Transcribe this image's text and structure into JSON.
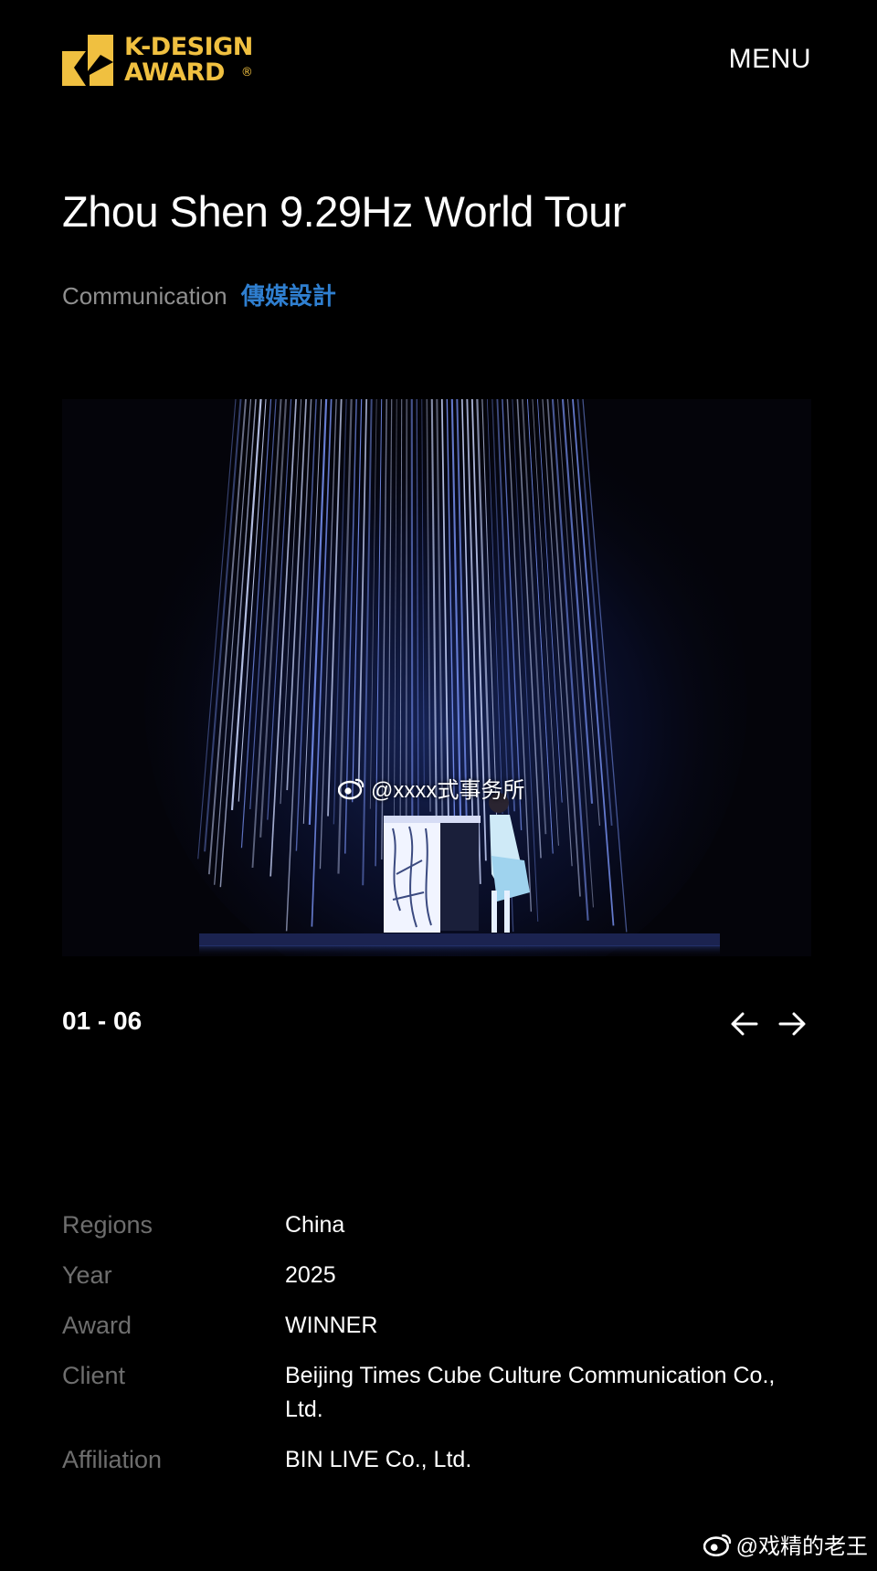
{
  "header": {
    "logo": {
      "line1": "K-DESIGN",
      "line2": "AWARD",
      "registered_mark": "®",
      "icon": "k-design-logo-mark",
      "color": "#f0c040"
    },
    "menu_label": "MENU"
  },
  "project": {
    "title": "Zhou Shen 9.29Hz World Tour",
    "category_en": "Communication",
    "category_cn": "傳媒設計",
    "category_cn_color": "#2f7fd0"
  },
  "gallery": {
    "counter": "01 - 06",
    "image_watermark": "@xxxx式事务所",
    "prev_icon": "arrow-left-icon",
    "next_icon": "arrow-right-icon"
  },
  "details": [
    {
      "label": "Regions",
      "value": "China"
    },
    {
      "label": "Year",
      "value": "2025"
    },
    {
      "label": "Award",
      "value": "WINNER"
    },
    {
      "label": "Client",
      "value": "Beijing Times Cube Culture Communication Co., Ltd."
    },
    {
      "label": "Affiliation",
      "value": "BIN LIVE Co., Ltd."
    }
  ],
  "footer_watermark": "@戏精的老王"
}
